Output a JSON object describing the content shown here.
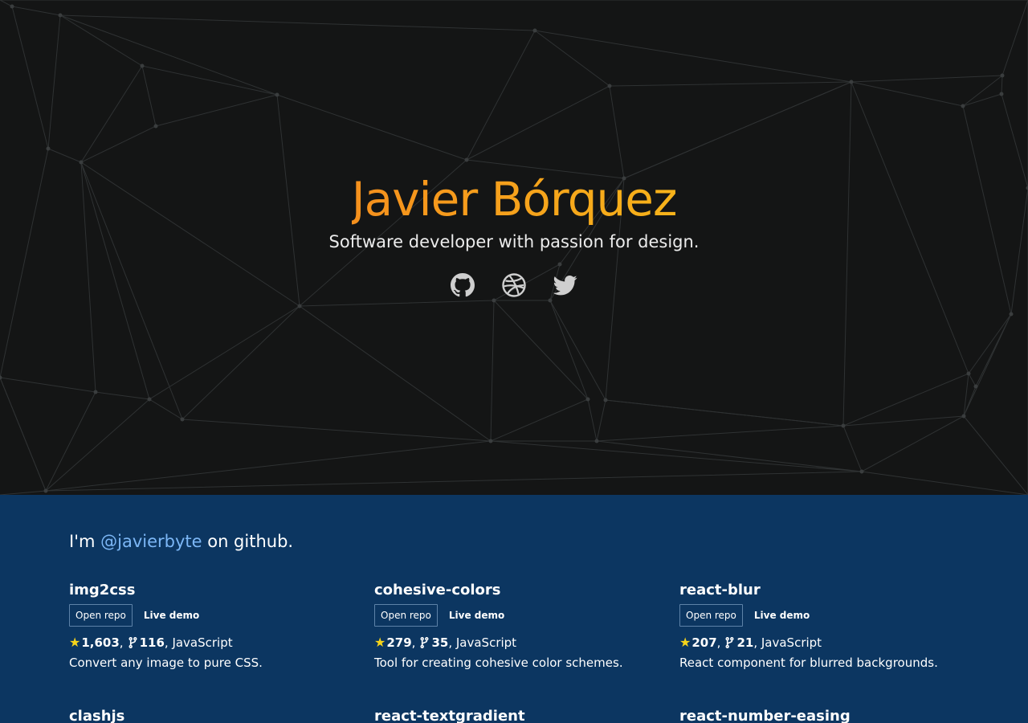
{
  "hero": {
    "title": "Javier Bórquez",
    "subtitle": "Software developer with passion for design.",
    "social": [
      {
        "icon": "github-icon",
        "label": "GitHub"
      },
      {
        "icon": "dribbble-icon",
        "label": "Dribbble"
      },
      {
        "icon": "twitter-icon",
        "label": "Twitter"
      }
    ],
    "colors": {
      "background": "#141515",
      "title_gradient_start": "#f5901d",
      "title_gradient_end": "#f7b31a",
      "mesh_line": "#2f3233",
      "mesh_node": "#3a3d3e"
    }
  },
  "projects": {
    "intro_prefix": "I'm ",
    "intro_handle": "@javierbyte",
    "intro_suffix": " on github.",
    "background": "#0c3661",
    "repos": [
      {
        "name": "img2css",
        "open_label": "Open repo",
        "demo_label": "Live demo",
        "stars": "1,603",
        "forks": "116",
        "language": "JavaScript",
        "description": "Convert any image to pure CSS."
      },
      {
        "name": "cohesive-colors",
        "open_label": "Open repo",
        "demo_label": "Live demo",
        "stars": "279",
        "forks": "35",
        "language": "JavaScript",
        "description": "Tool for creating cohesive color schemes."
      },
      {
        "name": "react-blur",
        "open_label": "Open repo",
        "demo_label": "Live demo",
        "stars": "207",
        "forks": "21",
        "language": "JavaScript",
        "description": "React component for blurred backgrounds."
      },
      {
        "name": "clashjs",
        "open_label": "",
        "demo_label": "",
        "stars": "",
        "forks": "",
        "language": "",
        "description": ""
      },
      {
        "name": "react-textgradient",
        "open_label": "",
        "demo_label": "",
        "stars": "",
        "forks": "",
        "language": "",
        "description": ""
      },
      {
        "name": "react-number-easing",
        "open_label": "",
        "demo_label": "",
        "stars": "",
        "forks": "",
        "language": "",
        "description": ""
      }
    ]
  }
}
